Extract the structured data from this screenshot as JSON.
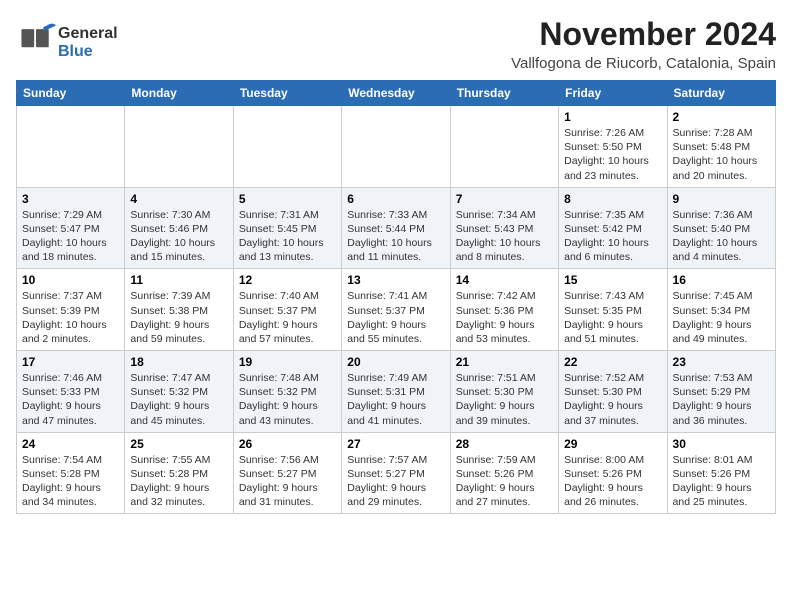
{
  "header": {
    "logo_line1": "General",
    "logo_line2": "Blue",
    "month": "November 2024",
    "location": "Vallfogona de Riucorb, Catalonia, Spain"
  },
  "weekdays": [
    "Sunday",
    "Monday",
    "Tuesday",
    "Wednesday",
    "Thursday",
    "Friday",
    "Saturday"
  ],
  "weeks": [
    [
      {
        "day": "",
        "info": ""
      },
      {
        "day": "",
        "info": ""
      },
      {
        "day": "",
        "info": ""
      },
      {
        "day": "",
        "info": ""
      },
      {
        "day": "",
        "info": ""
      },
      {
        "day": "1",
        "info": "Sunrise: 7:26 AM\nSunset: 5:50 PM\nDaylight: 10 hours and 23 minutes."
      },
      {
        "day": "2",
        "info": "Sunrise: 7:28 AM\nSunset: 5:48 PM\nDaylight: 10 hours and 20 minutes."
      }
    ],
    [
      {
        "day": "3",
        "info": "Sunrise: 7:29 AM\nSunset: 5:47 PM\nDaylight: 10 hours and 18 minutes."
      },
      {
        "day": "4",
        "info": "Sunrise: 7:30 AM\nSunset: 5:46 PM\nDaylight: 10 hours and 15 minutes."
      },
      {
        "day": "5",
        "info": "Sunrise: 7:31 AM\nSunset: 5:45 PM\nDaylight: 10 hours and 13 minutes."
      },
      {
        "day": "6",
        "info": "Sunrise: 7:33 AM\nSunset: 5:44 PM\nDaylight: 10 hours and 11 minutes."
      },
      {
        "day": "7",
        "info": "Sunrise: 7:34 AM\nSunset: 5:43 PM\nDaylight: 10 hours and 8 minutes."
      },
      {
        "day": "8",
        "info": "Sunrise: 7:35 AM\nSunset: 5:42 PM\nDaylight: 10 hours and 6 minutes."
      },
      {
        "day": "9",
        "info": "Sunrise: 7:36 AM\nSunset: 5:40 PM\nDaylight: 10 hours and 4 minutes."
      }
    ],
    [
      {
        "day": "10",
        "info": "Sunrise: 7:37 AM\nSunset: 5:39 PM\nDaylight: 10 hours and 2 minutes."
      },
      {
        "day": "11",
        "info": "Sunrise: 7:39 AM\nSunset: 5:38 PM\nDaylight: 9 hours and 59 minutes."
      },
      {
        "day": "12",
        "info": "Sunrise: 7:40 AM\nSunset: 5:37 PM\nDaylight: 9 hours and 57 minutes."
      },
      {
        "day": "13",
        "info": "Sunrise: 7:41 AM\nSunset: 5:37 PM\nDaylight: 9 hours and 55 minutes."
      },
      {
        "day": "14",
        "info": "Sunrise: 7:42 AM\nSunset: 5:36 PM\nDaylight: 9 hours and 53 minutes."
      },
      {
        "day": "15",
        "info": "Sunrise: 7:43 AM\nSunset: 5:35 PM\nDaylight: 9 hours and 51 minutes."
      },
      {
        "day": "16",
        "info": "Sunrise: 7:45 AM\nSunset: 5:34 PM\nDaylight: 9 hours and 49 minutes."
      }
    ],
    [
      {
        "day": "17",
        "info": "Sunrise: 7:46 AM\nSunset: 5:33 PM\nDaylight: 9 hours and 47 minutes."
      },
      {
        "day": "18",
        "info": "Sunrise: 7:47 AM\nSunset: 5:32 PM\nDaylight: 9 hours and 45 minutes."
      },
      {
        "day": "19",
        "info": "Sunrise: 7:48 AM\nSunset: 5:32 PM\nDaylight: 9 hours and 43 minutes."
      },
      {
        "day": "20",
        "info": "Sunrise: 7:49 AM\nSunset: 5:31 PM\nDaylight: 9 hours and 41 minutes."
      },
      {
        "day": "21",
        "info": "Sunrise: 7:51 AM\nSunset: 5:30 PM\nDaylight: 9 hours and 39 minutes."
      },
      {
        "day": "22",
        "info": "Sunrise: 7:52 AM\nSunset: 5:30 PM\nDaylight: 9 hours and 37 minutes."
      },
      {
        "day": "23",
        "info": "Sunrise: 7:53 AM\nSunset: 5:29 PM\nDaylight: 9 hours and 36 minutes."
      }
    ],
    [
      {
        "day": "24",
        "info": "Sunrise: 7:54 AM\nSunset: 5:28 PM\nDaylight: 9 hours and 34 minutes."
      },
      {
        "day": "25",
        "info": "Sunrise: 7:55 AM\nSunset: 5:28 PM\nDaylight: 9 hours and 32 minutes."
      },
      {
        "day": "26",
        "info": "Sunrise: 7:56 AM\nSunset: 5:27 PM\nDaylight: 9 hours and 31 minutes."
      },
      {
        "day": "27",
        "info": "Sunrise: 7:57 AM\nSunset: 5:27 PM\nDaylight: 9 hours and 29 minutes."
      },
      {
        "day": "28",
        "info": "Sunrise: 7:59 AM\nSunset: 5:26 PM\nDaylight: 9 hours and 27 minutes."
      },
      {
        "day": "29",
        "info": "Sunrise: 8:00 AM\nSunset: 5:26 PM\nDaylight: 9 hours and 26 minutes."
      },
      {
        "day": "30",
        "info": "Sunrise: 8:01 AM\nSunset: 5:26 PM\nDaylight: 9 hours and 25 minutes."
      }
    ]
  ]
}
